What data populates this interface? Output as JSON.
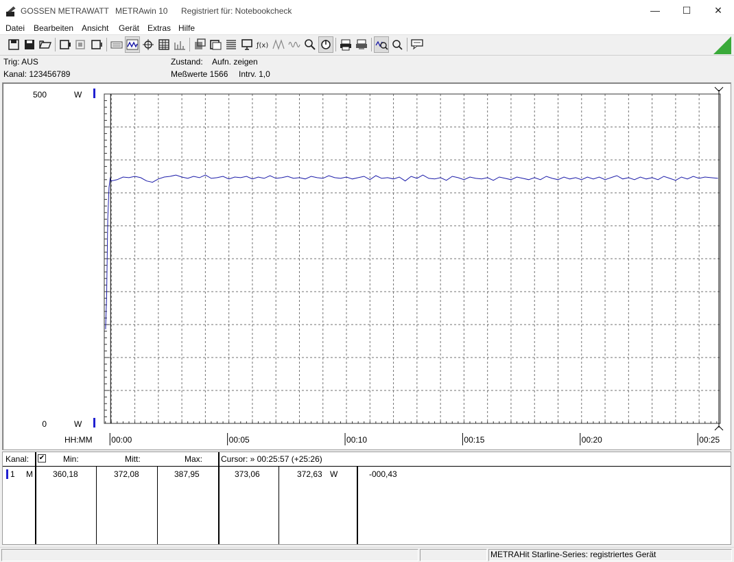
{
  "window": {
    "app_name": "GOSSEN METRAWATT",
    "product": "METRAwin 10",
    "registered": "Registriert für: Notebookcheck",
    "minimize": "—",
    "maximize": "☐",
    "close": "✕"
  },
  "menu": [
    "Datei",
    "Bearbeiten",
    "Ansicht",
    "Gerät",
    "Extras",
    "Hilfe"
  ],
  "toolbar": {
    "buttons": [
      {
        "icon": "save-icon"
      },
      {
        "icon": "save-as-icon"
      },
      {
        "icon": "open-folder-icon"
      },
      {
        "icon": "device-icon"
      },
      {
        "icon": "device-settings-icon"
      },
      {
        "icon": "device-read-icon"
      },
      {
        "icon": "keyboard-icon"
      },
      {
        "icon": "wave-view-icon",
        "pressed": true
      },
      {
        "icon": "crosshair-icon"
      },
      {
        "icon": "table-icon"
      },
      {
        "icon": "bars-icon"
      },
      {
        "icon": "export-icon"
      },
      {
        "icon": "multi-window-icon"
      },
      {
        "icon": "list-icon"
      },
      {
        "icon": "computer-icon"
      },
      {
        "icon": "function-icon"
      },
      {
        "icon": "peak-icon"
      },
      {
        "icon": "wave-icon"
      },
      {
        "icon": "record-icon"
      },
      {
        "icon": "power-icon",
        "pressed": true
      },
      {
        "icon": "print-icon"
      },
      {
        "icon": "print-preview-icon"
      },
      {
        "icon": "zoom-wave-icon",
        "pressed": true
      },
      {
        "icon": "zoom-icon"
      },
      {
        "icon": "comment-icon"
      }
    ]
  },
  "info": {
    "trig": "Trig: AUS",
    "kanal": "Kanal: 123456789",
    "zustand_label": "Zustand:",
    "zustand_value": "Aufn. zeigen",
    "messwerte": "Meßwerte 1566",
    "intrv": "Intrv. 1,0"
  },
  "colors": {
    "series": "#1a1aa8",
    "grid": "#707070",
    "marker": "#2020d0",
    "toolbar_triangle": "#3aaa3a"
  },
  "chart_data": {
    "type": "line",
    "y_top_label": "500",
    "y_bottom_label": "0",
    "y_unit": "W",
    "ylim": [
      0,
      500
    ],
    "x_axis_label": "HH:MM",
    "x_ticks": [
      "00:00",
      "00:05",
      "00:10",
      "00:15",
      "00:20",
      "00:25"
    ],
    "x_tick_minutes": [
      0,
      5,
      10,
      15,
      20,
      25
    ],
    "xlim_minutes": [
      -0.3,
      25.9
    ],
    "grid": true,
    "series": [
      {
        "points": [
          [
            -0.4,
            150
          ],
          [
            -0.3,
            143
          ],
          [
            -0.25,
            146
          ],
          [
            -0.2,
            190
          ],
          [
            -0.15,
            310
          ],
          [
            -0.1,
            358
          ],
          [
            -0.05,
            372
          ],
          [
            0.0,
            368
          ],
          [
            0.25,
            370
          ],
          [
            0.5,
            374
          ],
          [
            0.75,
            373
          ],
          [
            1.0,
            375
          ],
          [
            1.25,
            373
          ],
          [
            1.5,
            368
          ],
          [
            1.75,
            366
          ],
          [
            2.0,
            371
          ],
          [
            2.25,
            374
          ],
          [
            2.5,
            375
          ],
          [
            2.75,
            377
          ],
          [
            3.0,
            374
          ],
          [
            3.25,
            372
          ],
          [
            3.5,
            375
          ],
          [
            3.75,
            373
          ],
          [
            4.0,
            377
          ],
          [
            4.25,
            372
          ],
          [
            4.5,
            373
          ],
          [
            4.75,
            375
          ],
          [
            5.0,
            371
          ],
          [
            5.25,
            374
          ],
          [
            5.5,
            373
          ],
          [
            5.75,
            375
          ],
          [
            6.0,
            371
          ],
          [
            6.25,
            374
          ],
          [
            6.5,
            372
          ],
          [
            6.75,
            376
          ],
          [
            7.0,
            372
          ],
          [
            7.25,
            373
          ],
          [
            7.5,
            375
          ],
          [
            7.75,
            372
          ],
          [
            8.0,
            373
          ],
          [
            8.25,
            371
          ],
          [
            8.5,
            375
          ],
          [
            8.75,
            373
          ],
          [
            9.0,
            372
          ],
          [
            9.25,
            376
          ],
          [
            9.5,
            373
          ],
          [
            9.75,
            372
          ],
          [
            10.0,
            374
          ],
          [
            10.25,
            371
          ],
          [
            10.5,
            373
          ],
          [
            10.75,
            375
          ],
          [
            11.0,
            370
          ],
          [
            11.25,
            376
          ],
          [
            11.5,
            372
          ],
          [
            11.75,
            373
          ],
          [
            12.0,
            371
          ],
          [
            12.25,
            374
          ],
          [
            12.5,
            368
          ],
          [
            12.75,
            375
          ],
          [
            13.0,
            372
          ],
          [
            13.25,
            377
          ],
          [
            13.5,
            372
          ],
          [
            13.75,
            371
          ],
          [
            14.0,
            373
          ],
          [
            14.25,
            369
          ],
          [
            14.5,
            375
          ],
          [
            14.75,
            373
          ],
          [
            15.0,
            370
          ],
          [
            15.25,
            374
          ],
          [
            15.5,
            372
          ],
          [
            15.75,
            371
          ],
          [
            16.0,
            373
          ],
          [
            16.25,
            369
          ],
          [
            16.5,
            374
          ],
          [
            16.75,
            372
          ],
          [
            17.0,
            370
          ],
          [
            17.25,
            374
          ],
          [
            17.5,
            372
          ],
          [
            17.75,
            370
          ],
          [
            18.0,
            373
          ],
          [
            18.25,
            370
          ],
          [
            18.5,
            375
          ],
          [
            18.75,
            372
          ],
          [
            19.0,
            370
          ],
          [
            19.25,
            374
          ],
          [
            19.5,
            371
          ],
          [
            19.75,
            373
          ],
          [
            20.0,
            370
          ],
          [
            20.25,
            374
          ],
          [
            20.5,
            371
          ],
          [
            20.75,
            374
          ],
          [
            21.0,
            370
          ],
          [
            21.25,
            373
          ],
          [
            21.5,
            376
          ],
          [
            21.75,
            371
          ],
          [
            22.0,
            373
          ],
          [
            22.25,
            370
          ],
          [
            22.5,
            374
          ],
          [
            22.75,
            371
          ],
          [
            23.0,
            373
          ],
          [
            23.25,
            370
          ],
          [
            23.5,
            375
          ],
          [
            23.75,
            372
          ],
          [
            24.0,
            369
          ],
          [
            24.25,
            374
          ],
          [
            24.5,
            371
          ],
          [
            24.75,
            375
          ],
          [
            25.0,
            372
          ],
          [
            25.25,
            374
          ],
          [
            25.5,
            373
          ],
          [
            25.8,
            372
          ]
        ]
      }
    ]
  },
  "table": {
    "headers": {
      "kanal": "Kanal:",
      "min": "Min:",
      "mitt": "Mitt:",
      "max": "Max:",
      "cursor": "Cursor: » 00:25:57 (+25:26)"
    },
    "row": {
      "num": "1",
      "mode": "M",
      "min": "360,18",
      "mitt": "372,08",
      "max": "387,95",
      "cursor_val": "373,06",
      "cursor_val2": "372,63",
      "unit": "W",
      "delta": "-000,43"
    }
  },
  "status": {
    "text": "METRAHit Starline-Series: registriertes Gerät"
  }
}
